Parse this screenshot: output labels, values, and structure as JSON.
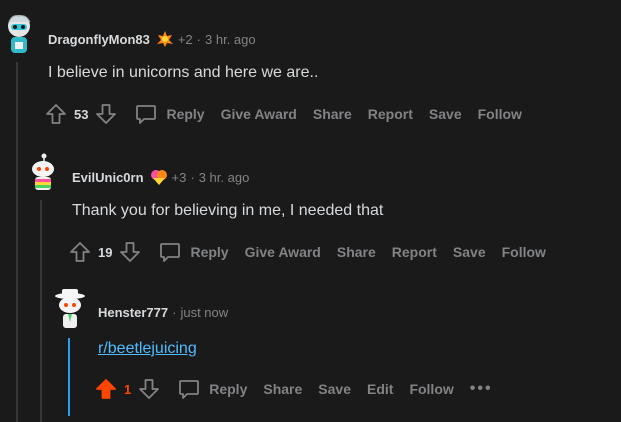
{
  "comments": [
    {
      "username": "DragonflyMon83",
      "karma_delta": "+2",
      "separator": "·",
      "time": "3 hr. ago",
      "text": "I believe in unicorns and here we are..",
      "votes": "53",
      "actions": [
        "Reply",
        "Give Award",
        "Share",
        "Report",
        "Save",
        "Follow"
      ]
    },
    {
      "username": "EvilUnic0rn",
      "karma_delta": "+3",
      "separator": "·",
      "time": "3 hr. ago",
      "text": "Thank you for believing in me, I needed that",
      "votes": "19",
      "actions": [
        "Reply",
        "Give Award",
        "Share",
        "Report",
        "Save",
        "Follow"
      ]
    },
    {
      "username": "Henster777",
      "separator": "·",
      "time": "just now",
      "link_text": "r/beetlejuicing",
      "votes": "1",
      "actions": [
        "Reply",
        "Share",
        "Save",
        "Edit",
        "Follow"
      ],
      "more": "•••"
    }
  ],
  "colors": {
    "background": "#1a1a1b",
    "upvote_active": "#ff4500",
    "link": "#4fbcff",
    "muted": "#818384"
  }
}
